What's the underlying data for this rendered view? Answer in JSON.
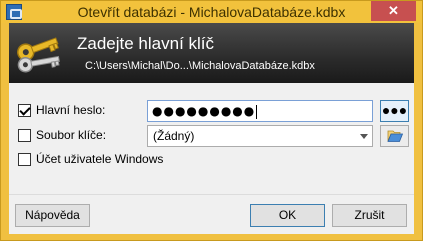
{
  "window": {
    "title": "Otevřít databázi - MichalovaDatabáze.kdbx",
    "close_symbol": "✕"
  },
  "banner": {
    "title": "Zadejte hlavní klíč",
    "path": "C:\\Users\\Michal\\Do...\\MichalovaDatabáze.kdbx",
    "icon": "keys-icon"
  },
  "form": {
    "master_password": {
      "label": "Hlavní heslo:",
      "checked": true,
      "value": "●●●●●●●●●",
      "reveal_label": "●●●"
    },
    "key_file": {
      "label": "Soubor klíče:",
      "checked": false,
      "selected": "(Žádný)",
      "browse_icon": "folder-open-icon"
    },
    "windows_account": {
      "label": "Účet uživatele Windows",
      "checked": false
    }
  },
  "buttons": {
    "help": "Nápověda",
    "ok": "OK",
    "cancel": "Zrušit"
  },
  "colors": {
    "title_bar": "#f2c23c",
    "close_button": "#c75050",
    "banner_dark": "#2b2b2b",
    "focus_blue": "#3c7fb1"
  }
}
